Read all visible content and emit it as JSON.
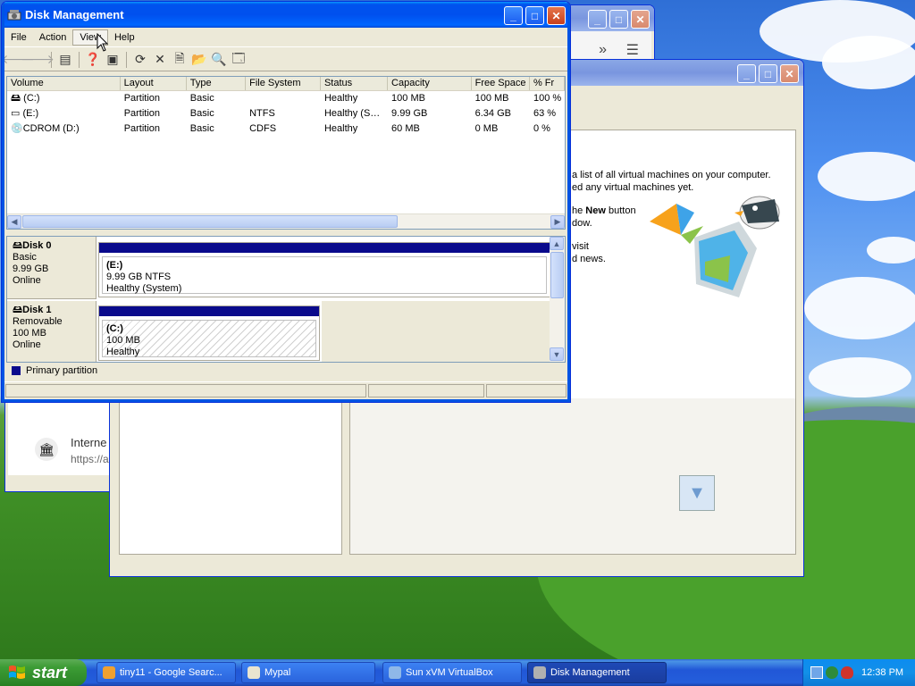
{
  "disk_mgmt": {
    "title": "Disk Management",
    "menu": [
      "File",
      "Action",
      "View",
      "Help"
    ],
    "columns": [
      "Volume",
      "Layout",
      "Type",
      "File System",
      "Status",
      "Capacity",
      "Free Space",
      "% Fr"
    ],
    "volumes": [
      [
        "(C:)",
        "Partition",
        "Basic",
        "",
        "Healthy",
        "100 MB",
        "100 MB",
        "100 %"
      ],
      [
        "(E:)",
        "Partition",
        "Basic",
        "NTFS",
        "Healthy (S…",
        "9.99 GB",
        "6.34 GB",
        "63 %"
      ],
      [
        "CDROM (D:)",
        "Partition",
        "Basic",
        "CDFS",
        "Healthy",
        "60 MB",
        "0 MB",
        "0 %"
      ]
    ],
    "disks": [
      {
        "name": "Disk 0",
        "kind": "Basic",
        "size": "9.99 GB",
        "state": "Online",
        "partition": {
          "letter": "(E:)",
          "size_fs": "9.99 GB NTFS",
          "status": "Healthy (System)"
        }
      },
      {
        "name": "Disk 1",
        "kind": "Removable",
        "size": "100 MB",
        "state": "Online",
        "partition": {
          "letter": "(C:)",
          "size_fs": "100 MB",
          "status": "Healthy"
        }
      }
    ],
    "legend": "Primary partition",
    "colors": {
      "primary_partition": "#0a0a8c"
    }
  },
  "virtualbox": {
    "text_line1": "a list of all virtual machines on your computer.",
    "text_line2": "ed any virtual machines yet.",
    "text_line3_pre": "he ",
    "text_line3_bold": "New",
    "text_line3_post": " button",
    "text_line4": "dow.",
    "text_line5": "visit",
    "text_line6": "d news."
  },
  "browser": {
    "item_title": "Interne",
    "item_url": "https://ar"
  },
  "taskbar": {
    "start": "start",
    "tasks": [
      "tiny11 - Google Searc...",
      "Mypal",
      "Sun xVM VirtualBox",
      "Disk Management"
    ],
    "clock": "12:38 PM"
  }
}
